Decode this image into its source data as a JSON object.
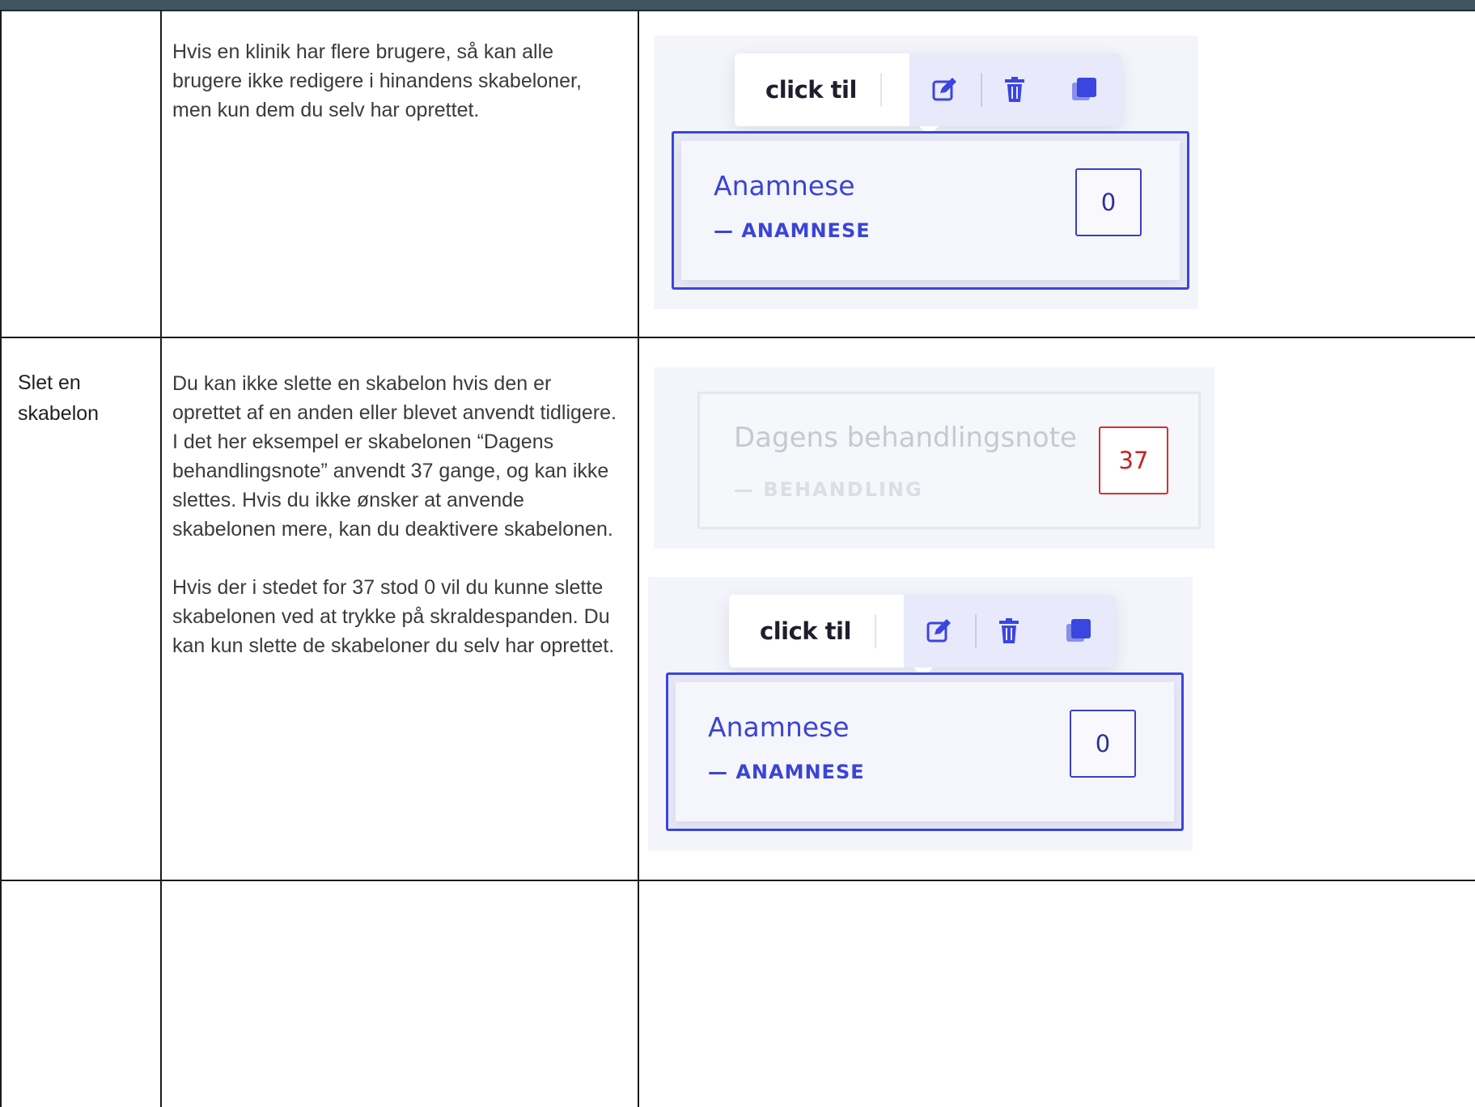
{
  "rows": [
    {
      "label": "",
      "paragraphs": [
        "Hvis en klinik har flere brugere, så kan alle brugere ikke redigere i hinandens skabeloner, men kun dem du selv har oprettet."
      ]
    },
    {
      "label": "Slet en skabelon",
      "paragraphs": [
        "Du kan ikke slette en skabelon hvis den er oprettet af en anden eller blevet anvendt tidligere. I det her eksempel er skabelonen “Dagens behandlingsnote” anvendt 37 gange, og kan ikke slettes. Hvis du ikke ønsker at anvende skabelonen mere, kan du deaktivere skabelonen.",
        "Hvis der i stedet for 37 stod 0 vil du kunne slette skabelonen ved at trykke på skraldespanden. Du kan kun slette de skabeloner du selv har oprettet."
      ]
    }
  ],
  "shot_1": {
    "toolbar_text": "click til",
    "card_title": "Anamnese",
    "card_sub": "— ANAMNESE",
    "count": "0"
  },
  "shot_2": {
    "card_title": "Dagens behandlingsnote",
    "card_sub": "— BEHANDLING",
    "count": "37"
  },
  "shot_3": {
    "toolbar_text": "click til",
    "card_title": "Anamnese",
    "card_sub": "— ANAMNESE",
    "count": "0"
  },
  "icons": {
    "edit": "edit-icon",
    "delete": "trash-icon",
    "copy": "copy-icon"
  },
  "colors": {
    "accent": "#3b45e0",
    "danger": "#d62f2f",
    "topbar": "#3f5662"
  }
}
